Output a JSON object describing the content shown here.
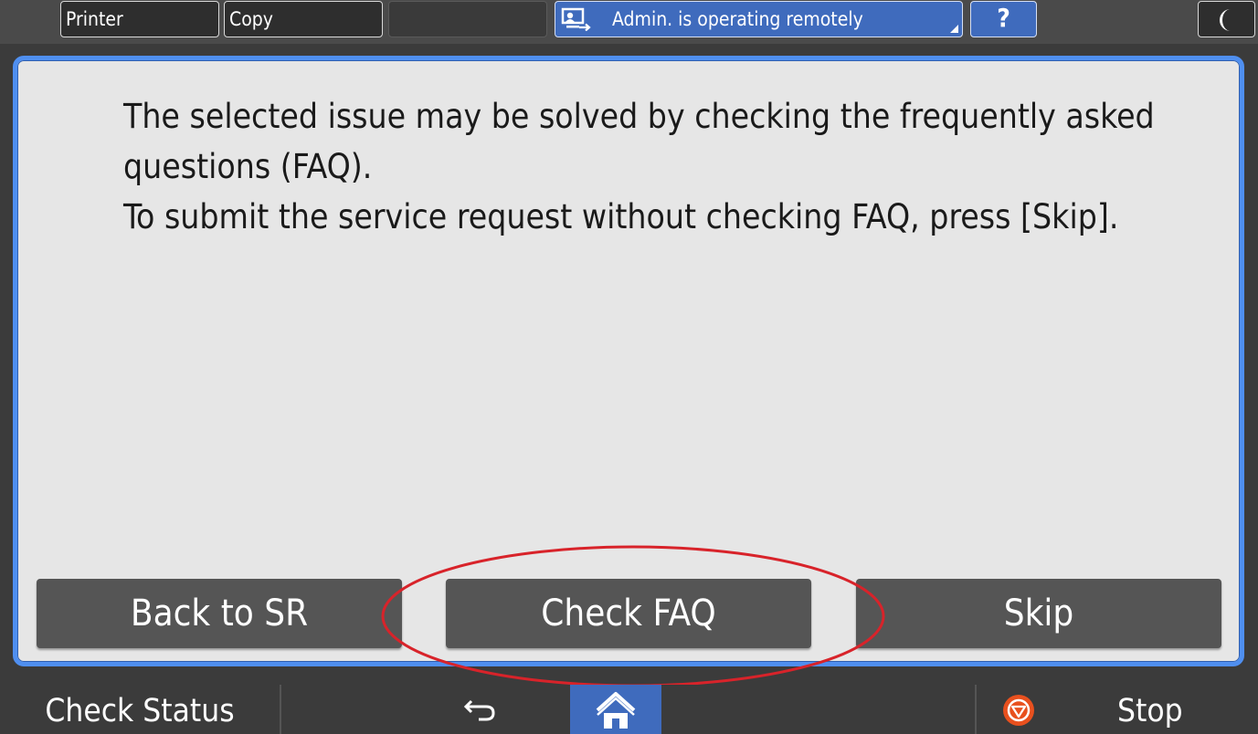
{
  "topbar": {
    "tabs": [
      {
        "label": "Printer"
      },
      {
        "label": "Copy"
      },
      {
        "label": ""
      }
    ],
    "remote_status": "Admin. is operating remotely",
    "help_label": "?"
  },
  "dialog": {
    "message_line1": "The selected issue may be solved by checking the frequently asked questions (FAQ).",
    "message_line2": "To submit the service request without checking FAQ, press [Skip].",
    "buttons": {
      "back": "Back to SR",
      "check_faq": "Check FAQ",
      "skip": "Skip"
    }
  },
  "bottombar": {
    "check_status": "Check Status",
    "stop": "Stop"
  },
  "colors": {
    "accent_blue": "#3f6bbd",
    "dialog_border": "#4f8ff0",
    "annotation_red": "#d8232a",
    "stop_orange": "#e8501e"
  },
  "icons": {
    "remote": "remote-operation-icon",
    "sleep": "moon-icon",
    "back": "back-arrow-icon",
    "home": "home-icon",
    "stop": "stop-icon"
  }
}
